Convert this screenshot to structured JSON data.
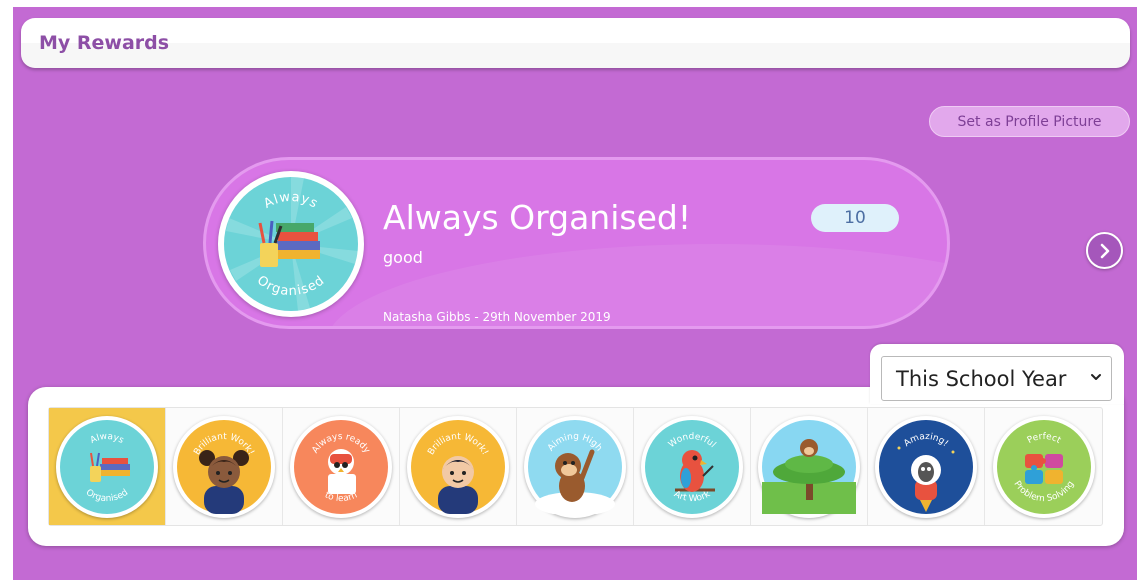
{
  "header": {
    "title": "My Rewards"
  },
  "actions": {
    "profile_picture_label": "Set as Profile Picture"
  },
  "featured": {
    "title": "Always Organised!",
    "description": "good",
    "count": "10",
    "awarded_by": "Natasha Gibbs - 29th November 2019",
    "badge_label_top": "Always",
    "badge_label_bottom": "Organised"
  },
  "filter": {
    "selected": "This School Year"
  },
  "badges": [
    {
      "label_top": "Always",
      "label_bottom": "Organised",
      "bg": "#6cd3d7",
      "icon": "books-icon",
      "selected": true
    },
    {
      "label_top": "Brilliant Work!",
      "label_bottom": "",
      "bg": "#f6b836",
      "icon": "girl-icon",
      "selected": false
    },
    {
      "label_top": "Always ready",
      "label_bottom": "to learn",
      "bg": "#f7875c",
      "icon": "owl-icon",
      "selected": false
    },
    {
      "label_top": "Brilliant Work!",
      "label_bottom": "",
      "bg": "#f6b836",
      "icon": "boy-icon",
      "selected": false
    },
    {
      "label_top": "Aiming High",
      "label_bottom": "",
      "bg": "#8fdaf0",
      "icon": "monkey-icon",
      "selected": false
    },
    {
      "label_top": "Wonderful",
      "label_bottom": "Art Work",
      "bg": "#6cd3d7",
      "icon": "parrot-icon",
      "selected": false
    },
    {
      "label_top": "",
      "label_bottom": "",
      "bg": "#88d7f2",
      "icon": "tree-monkey-icon",
      "selected": false
    },
    {
      "label_top": "Amazing!",
      "label_bottom": "",
      "bg": "#1e4f9a",
      "icon": "rocket-sheep-icon",
      "selected": false
    },
    {
      "label_top": "Perfect",
      "label_bottom": "Problem Solving",
      "bg": "#9bcf5a",
      "icon": "puzzle-icon",
      "selected": false
    }
  ],
  "colors": {
    "background": "#c36ad3",
    "card": "#d876e6",
    "selected_tile": "#f4c84a",
    "count_pill": "#dff1fb"
  }
}
